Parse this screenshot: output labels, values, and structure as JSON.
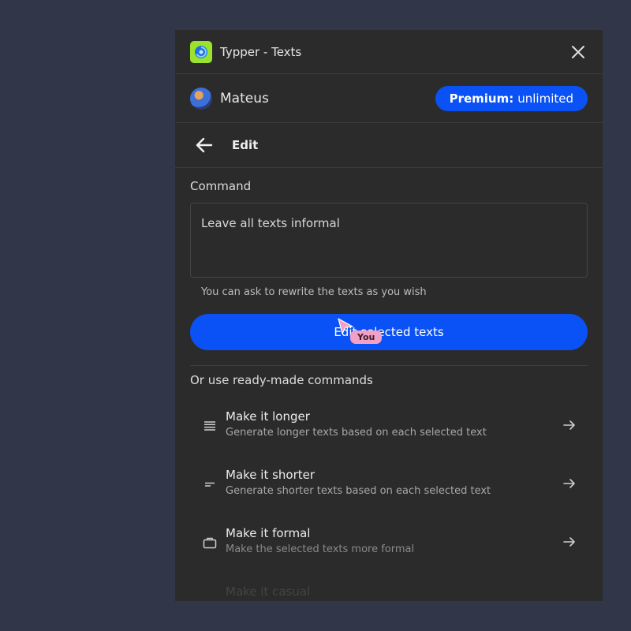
{
  "window": {
    "title": "Typper - Texts"
  },
  "user": {
    "name": "Mateus"
  },
  "premium": {
    "label": "Premium:",
    "value": "unlimited"
  },
  "nav": {
    "title": "Edit"
  },
  "command": {
    "label": "Command",
    "value": "Leave all texts informal",
    "hint": "You can ask to rewrite the texts as you wish"
  },
  "primary_button": {
    "label": "Edit selected texts"
  },
  "cursor": {
    "tag": "You"
  },
  "ready_made": {
    "title": "Or use ready-made commands",
    "items": [
      {
        "title": "Make it longer",
        "desc": "Generate longer texts based on each selected text",
        "icon": "lines-icon"
      },
      {
        "title": "Make it shorter",
        "desc": "Generate shorter texts based on each selected text",
        "icon": "short-lines-icon"
      },
      {
        "title": "Make it formal",
        "desc": "Make the selected texts more formal",
        "icon": "briefcase-icon"
      },
      {
        "title": "Make it casual",
        "desc": "",
        "icon": "casual-icon"
      }
    ]
  },
  "colors": {
    "accent": "#0a52f5",
    "panel": "#2b2b2b",
    "background": "#323649",
    "logo": "#9be22d"
  }
}
